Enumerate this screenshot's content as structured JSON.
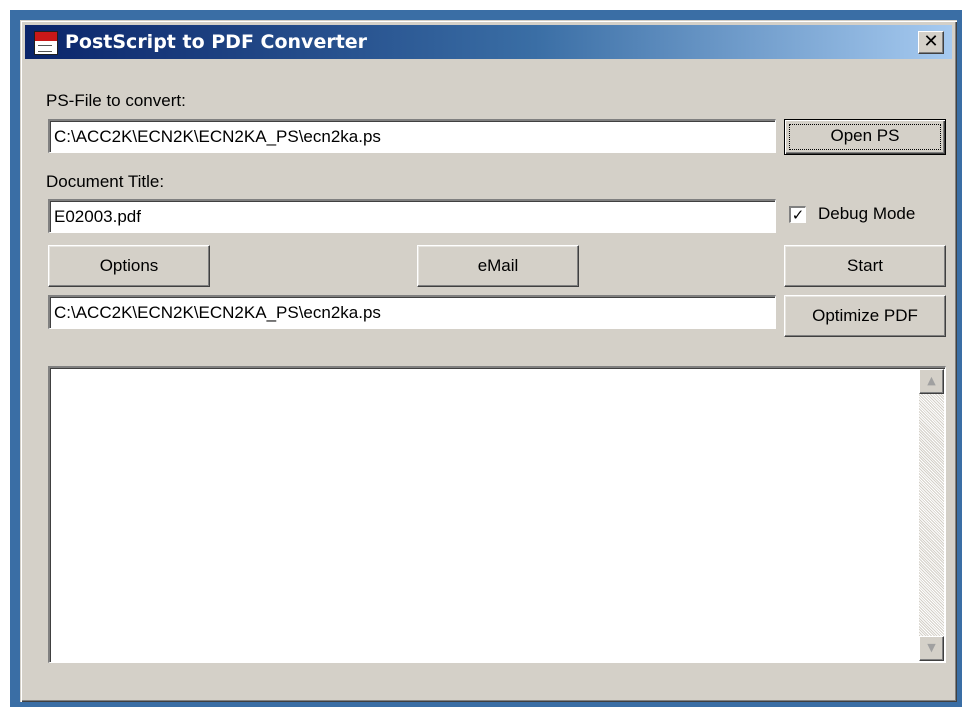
{
  "window": {
    "title": "PostScript to PDF Converter",
    "close_glyph": "✕"
  },
  "ps_file": {
    "label": "PS-File to convert:",
    "value": "C:\\ACC2K\\ECN2K\\ECN2KA_PS\\ecn2ka.ps",
    "open_button": "Open PS"
  },
  "doc_title": {
    "label": "Document Title:",
    "value": "E02003.pdf"
  },
  "debug": {
    "label": "Debug Mode",
    "checked": true,
    "check_glyph": "✓"
  },
  "buttons": {
    "options": "Options",
    "email": "eMail",
    "start": "Start",
    "optimize": "Optimize PDF"
  },
  "output": {
    "value": "C:\\ACC2K\\ECN2K\\ECN2KA_PS\\ecn2ka.ps"
  },
  "log": {
    "scroll_up": "▲",
    "scroll_down": "▼"
  },
  "colors": {
    "titlebar_start": "#0a246a",
    "titlebar_end": "#a6caf0",
    "face": "#d4d0c8",
    "desktop": "#3a6ea5"
  },
  "icons": {
    "app": "pdf-app-icon",
    "close": "close-icon",
    "scroll_up": "scroll-up-arrow-icon",
    "scroll_down": "scroll-down-arrow-icon",
    "checkmark": "checkmark-icon"
  }
}
